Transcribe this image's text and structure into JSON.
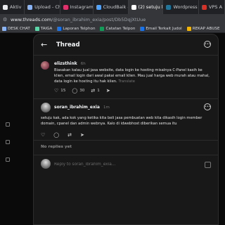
{
  "browser": {
    "tabs": [
      {
        "label": "Aktiv",
        "favicon_color": "#e8eaed"
      },
      {
        "label": "Upload - Ch",
        "favicon_color": "#8ab4f8"
      },
      {
        "label": "Instagram",
        "favicon_color": "#e1306c"
      },
      {
        "label": "CloudBaik - ",
        "favicon_color": "#4da3ff"
      },
      {
        "label": "(2) setuju k",
        "favicon_color": "#ffffff"
      },
      {
        "label": "Wordpress i",
        "favicon_color": "#21759b"
      },
      {
        "label": "VPS A",
        "favicon_color": "#d93025"
      }
    ],
    "active_tab_index": 4,
    "url_host": "www.threads.com",
    "url_path": "/@soran_ibrahim_exia/post/Db5DqjXtUue",
    "bookmarks": [
      {
        "label": "DESK CHAT",
        "icon_color": "#8ab4f8"
      },
      {
        "label": "TAIGA",
        "icon_color": "#5ad7a8"
      },
      {
        "label": "Laporan Telphon",
        "icon_color": "#1a73e8"
      },
      {
        "label": "Catatan Telpon",
        "icon_color": "#0f9d58"
      },
      {
        "label": "Email Terkait Judol",
        "icon_color": "#1a73e8"
      },
      {
        "label": "REKAP ABUSE",
        "icon_color": "#f4b400"
      }
    ]
  },
  "thread": {
    "title": "Thread",
    "back_icon": "arrow-left-icon",
    "more_icon": "more-icon",
    "post": {
      "username": "elizsthink",
      "time": "6h",
      "text": "Biasakan kalau jual jasa website, data login ke hosting misalnya C-Panel kasih ke klien, email login dari awal pakai email klien. Mau jual harga web murah atau mahal, data login ke hosting itu hak klien.",
      "translate": "Translate",
      "likes": "15",
      "replies": "30",
      "reposts": "1"
    },
    "reply": {
      "username": "soran_ibrahim_exia",
      "time": "1m",
      "text": "setuju kak, ada kok yang ketika kita beli jasa pembuatan web kita dikasih login member domain, cpanel dan admin webnya. Kalo di idwebhost diberikan semua itu"
    },
    "no_replies": "No replies yet",
    "composer_placeholder": "Reply to soran_ibrahim_exia..."
  }
}
